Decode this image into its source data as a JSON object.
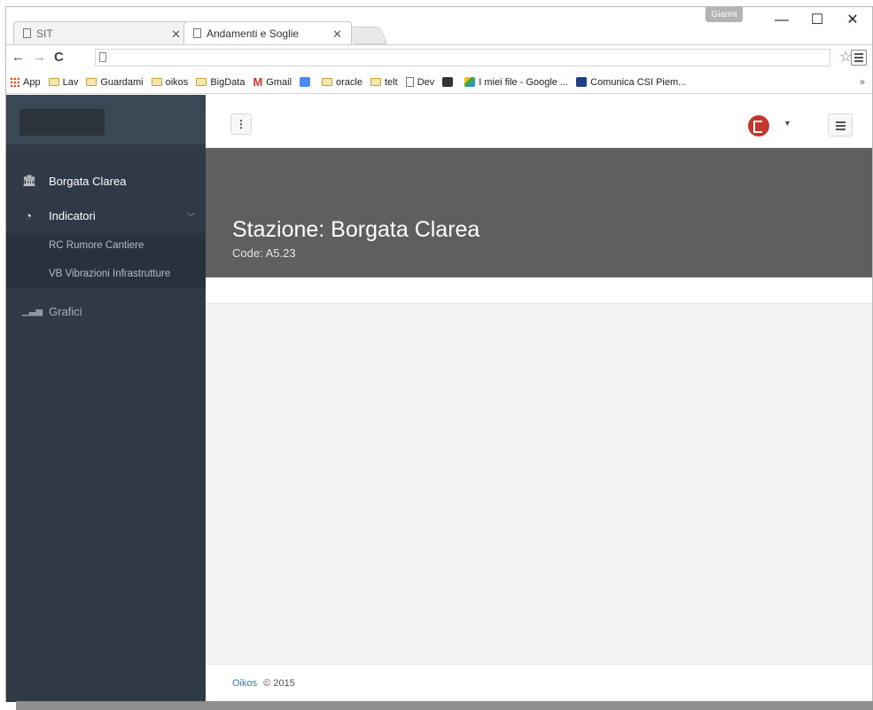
{
  "browser": {
    "tabs": [
      {
        "title": "SIT"
      },
      {
        "title": "Andamenti e Soglie"
      }
    ],
    "profile_name": "Gianni",
    "window_controls": {
      "minimize": "—",
      "maximize": "☐",
      "close": "✕"
    },
    "bookmarks": [
      {
        "label": "App",
        "icon": "apps-grid-icon"
      },
      {
        "label": "Lav",
        "icon": "folder-icon"
      },
      {
        "label": "Guardami",
        "icon": "folder-icon"
      },
      {
        "label": "oikos",
        "icon": "folder-icon"
      },
      {
        "label": "BigData",
        "icon": "folder-icon"
      },
      {
        "label": "Gmail",
        "icon": "gmail-icon"
      },
      {
        "label": "",
        "icon": "translate-icon"
      },
      {
        "label": "oracle",
        "icon": "folder-icon"
      },
      {
        "label": "telt",
        "icon": "folder-icon"
      },
      {
        "label": "Dev",
        "icon": "page-icon"
      },
      {
        "label": "",
        "icon": "book-icon"
      },
      {
        "label": "I miei file - Google ...",
        "icon": "google-drive-icon"
      },
      {
        "label": "Comunica CSI Piem...",
        "icon": "uc-icon"
      }
    ],
    "bookmarks_overflow": "»"
  },
  "sidebar": {
    "station": "Borgata Clarea",
    "indicatori": "Indicatori",
    "sub_items": [
      "RC Rumore Cantiere",
      "VB Vibrazioni Infrastrutture"
    ],
    "grafici": "Grafici"
  },
  "header": {
    "kebab": "⋮"
  },
  "banner": {
    "title": "Stazione: Borgata Clarea",
    "code": "Code: A5.23"
  },
  "footer": {
    "brand": "Oikos",
    "copyright": "© 2015"
  },
  "colors": {
    "sidebar_bg": "#2f3a46",
    "banner_bg": "#5f5f5f",
    "accent_link": "#2f7cc1",
    "brand_red": "#c0392b"
  }
}
